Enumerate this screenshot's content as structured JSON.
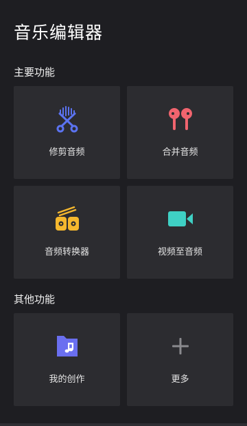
{
  "app_title": "音乐编辑器",
  "sections": {
    "primary": {
      "title": "主要功能",
      "items": [
        {
          "label": "修剪音频",
          "icon": "scissors-audio-icon",
          "color": "#5b73f0"
        },
        {
          "label": "合并音频",
          "icon": "earbuds-icon",
          "color": "#f0646e"
        },
        {
          "label": "音频转换器",
          "icon": "converter-icon",
          "color": "#f5b82e"
        },
        {
          "label": "视频至音频",
          "icon": "video-camera-icon",
          "color": "#3fd0c4"
        }
      ]
    },
    "other": {
      "title": "其他功能",
      "items": [
        {
          "label": "我的创作",
          "icon": "music-folder-icon",
          "color": "#6a6ff0"
        },
        {
          "label": "更多",
          "icon": "plus-icon",
          "color": "#8a8a8e"
        }
      ]
    }
  }
}
